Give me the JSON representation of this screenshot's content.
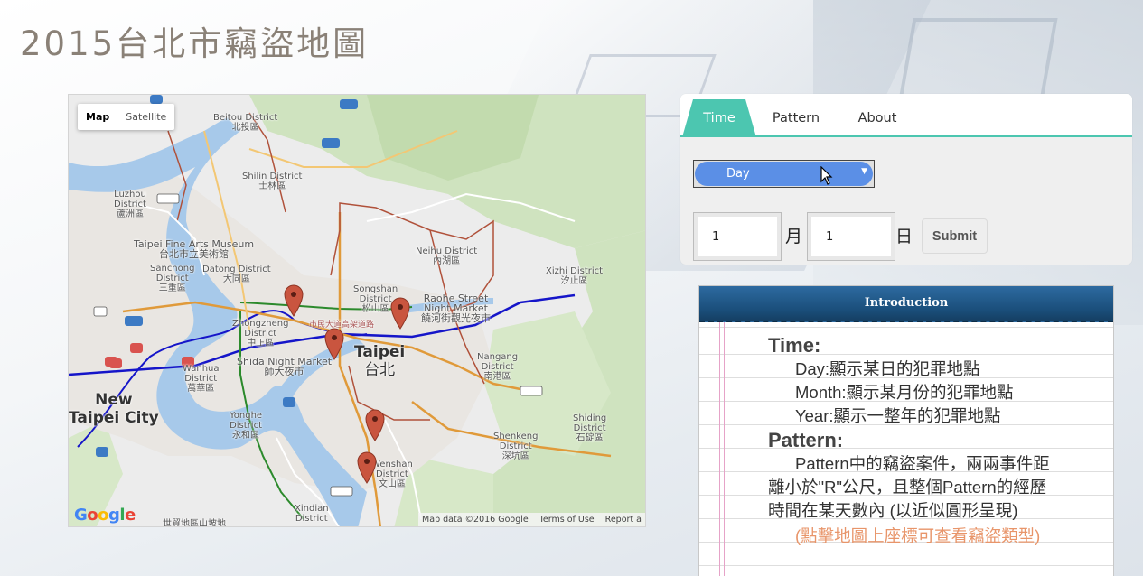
{
  "page": {
    "title": "2015台北市竊盜地圖"
  },
  "map": {
    "type_control": {
      "map": "Map",
      "satellite": "Satellite"
    },
    "footer": {
      "data": "Map data ©2016 Google",
      "terms": "Terms of Use",
      "report": "Report a"
    },
    "logo": [
      "G",
      "o",
      "o",
      "g",
      "l",
      "e"
    ],
    "labels": {
      "beitou": "Beitou District",
      "beitou_zh": "北投區",
      "shilin": "Shilin District",
      "shilin_zh": "士林區",
      "luzhou": "Luzhou",
      "luzhou2": "District",
      "luzhou_zh": "蘆洲區",
      "fineart": "Taipei Fine Arts Museum",
      "fineart_zh": "台北市立美術館",
      "sanchong": "Sanchong",
      "sanchong2": "District",
      "sanchong_zh": "三重區",
      "datong": "Datong District",
      "datong_zh": "大同區",
      "neihu": "Neihu District",
      "neihu_zh": "內湖區",
      "songshan": "Songshan",
      "songshan2": "District",
      "songshan_zh": "松山區",
      "raohe": "Raohe Street",
      "raohe2": "Night Market",
      "raohe_zh": "饒河街觀光夜市",
      "xizhi": "Xizhi District",
      "xizhi_zh": "汐止區",
      "zhongzheng": "Zhongzheng",
      "zhongzheng2": "District",
      "zhongzheng_zh": "中正區",
      "market_zh": "市民大道高架道路",
      "taipei": "Taipei",
      "taipei_zh": "台北",
      "shida": "Shida Night Market",
      "shida_zh": "師大夜市",
      "wanhua": "Wanhua",
      "wanhua2": "District",
      "wanhua_zh": "萬華區",
      "newtaipei": "New",
      "newtaipei2": "Taipei City",
      "nangang": "Nangang",
      "nangang2": "District",
      "nangang_zh": "南港區",
      "yonghe": "Yonghe",
      "yonghe2": "District",
      "yonghe_zh": "永和區",
      "shiding": "Shiding",
      "shiding2": "District",
      "shiding_zh": "石碇區",
      "shenkeng": "Shenkeng",
      "shenkeng2": "District",
      "shenkeng_zh": "深坑區",
      "wenshan": "Wenshan",
      "wenshan2": "District",
      "wenshan_zh": "文山區",
      "xindian": "Xindian",
      "xindian2": "District",
      "taipei_zh_bottom": "世貿地區山坡地"
    },
    "marker_count": 6
  },
  "tabs": [
    {
      "label": "Time",
      "active": true
    },
    {
      "label": "Pattern",
      "active": false
    },
    {
      "label": "About",
      "active": false
    }
  ],
  "controls": {
    "period_select": {
      "value": "Day"
    },
    "month_input": {
      "value": "1",
      "unit": "月"
    },
    "day_input": {
      "value": "1",
      "unit": "日"
    },
    "submit_label": "Submit"
  },
  "intro": {
    "heading": "Introduction",
    "time_title": "Time:",
    "time_lines": [
      "Day:顯示某日的犯罪地點",
      "Month:顯示某月份的犯罪地點",
      "Year:顯示一整年的犯罪地點"
    ],
    "pattern_title": "Pattern:",
    "pattern_text": "Pattern中的竊盜案件，兩兩事件距離小於\"R\"公尺，且整個Pattern的經歷時間在某天數內 (以近似圓形呈現)",
    "note": "(點擊地圖上座標可查看竊盜類型)"
  }
}
